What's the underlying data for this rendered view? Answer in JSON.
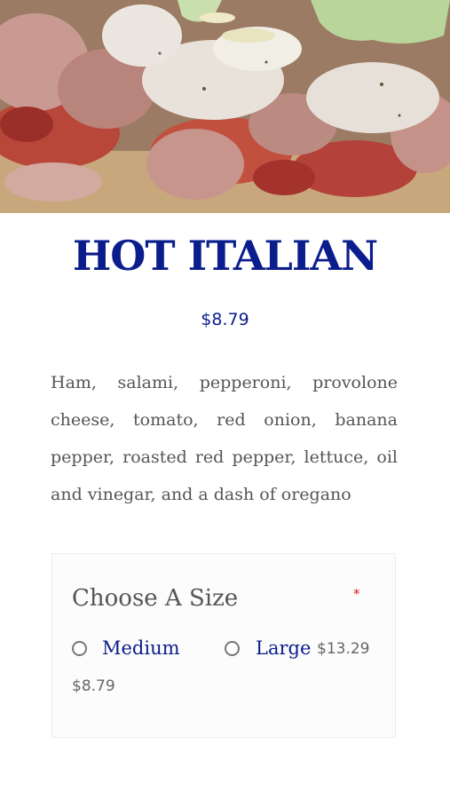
{
  "product": {
    "image_alt": "Hot Italian sandwich photo",
    "title": "HOT ITALIAN",
    "price": "$8.79",
    "description": "Ham, salami, pepperoni, provolone cheese, tomato, red onion, banana pepper, roasted red pepper, lettuce, oil and vinegar, and a dash of oregano"
  },
  "options": {
    "title": "Choose A Size",
    "required_mark": "*",
    "choices": [
      {
        "label": "Medium",
        "price": "$8.79"
      },
      {
        "label": "Large",
        "price": "$13.29"
      }
    ]
  },
  "colors": {
    "title": "#0b1c8c",
    "body_text": "#555555",
    "required": "#d41c1c"
  }
}
